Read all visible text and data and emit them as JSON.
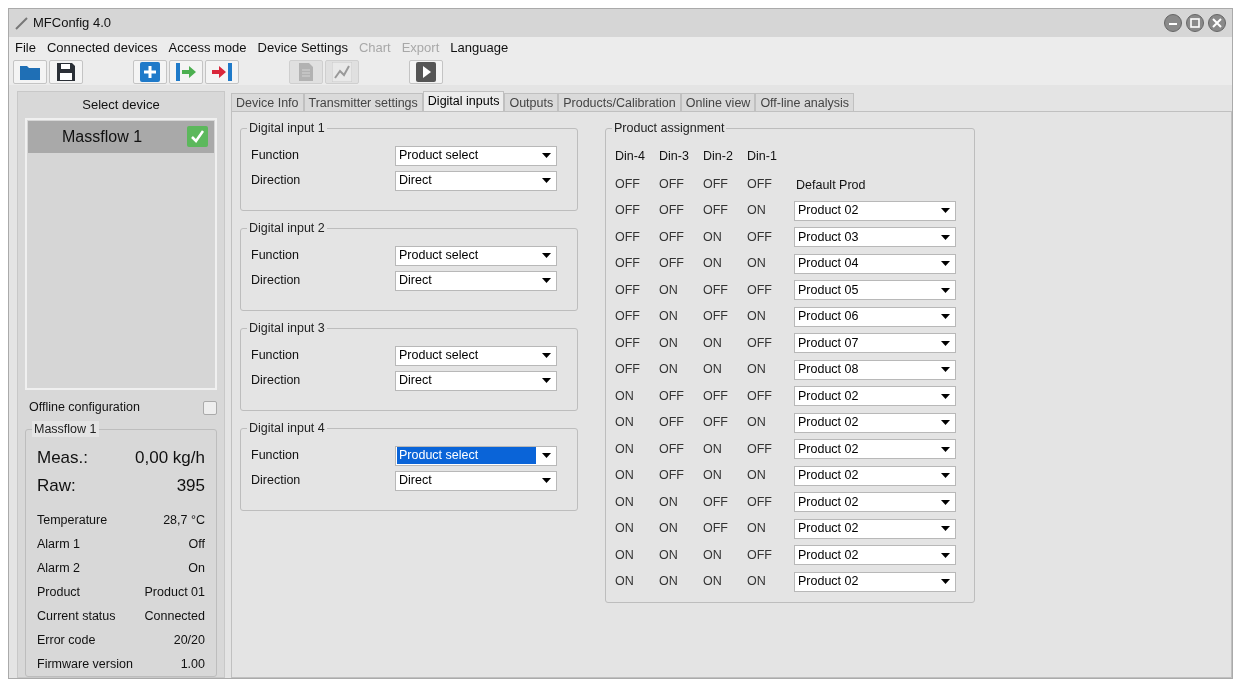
{
  "window": {
    "title": "MFConfig 4.0"
  },
  "menu": [
    {
      "label": "File",
      "disabled": false
    },
    {
      "label": "Connected devices",
      "disabled": false
    },
    {
      "label": "Access mode",
      "disabled": false
    },
    {
      "label": "Device Settings",
      "disabled": false
    },
    {
      "label": "Chart",
      "disabled": true
    },
    {
      "label": "Export",
      "disabled": true
    },
    {
      "label": "Language",
      "disabled": false
    }
  ],
  "toolbar": [
    {
      "kind": "open",
      "disabled": false
    },
    {
      "kind": "save",
      "disabled": false
    },
    {
      "kind": "gap"
    },
    {
      "kind": "add",
      "disabled": false
    },
    {
      "kind": "connect",
      "disabled": false
    },
    {
      "kind": "disconnect",
      "disabled": false
    },
    {
      "kind": "gap"
    },
    {
      "kind": "document",
      "disabled": true
    },
    {
      "kind": "chart",
      "disabled": true
    },
    {
      "kind": "gap"
    },
    {
      "kind": "play",
      "disabled": false
    }
  ],
  "sidebar": {
    "title": "Select device",
    "devices": [
      {
        "name": "Massflow 1",
        "selected": true,
        "connected": true
      }
    ],
    "offline": {
      "label": "Offline configuration",
      "checked": false
    },
    "status": {
      "title": "Massflow 1",
      "big": [
        {
          "label": "Meas.:",
          "value": "0,00 kg/h"
        },
        {
          "label": "Raw:",
          "value": "395"
        }
      ],
      "rows": [
        {
          "label": "Temperature",
          "value": "28,7 °C"
        },
        {
          "label": "Alarm 1",
          "value": "Off"
        },
        {
          "label": "Alarm 2",
          "value": "On"
        },
        {
          "label": "Product",
          "value": "Product 01"
        },
        {
          "label": "Current status",
          "value": "Connected"
        },
        {
          "label": "Error code",
          "value": "20/20"
        },
        {
          "label": "Firmware version",
          "value": "1.00"
        }
      ]
    }
  },
  "tabs": [
    {
      "label": "Device Info",
      "selected": false
    },
    {
      "label": "Transmitter settings",
      "selected": false
    },
    {
      "label": "Digital inputs",
      "selected": true
    },
    {
      "label": "Outputs",
      "selected": false
    },
    {
      "label": "Products/Calibration",
      "selected": false
    },
    {
      "label": "Online view",
      "selected": false
    },
    {
      "label": "Off-line analysis",
      "selected": false
    }
  ],
  "digital_inputs": [
    {
      "title": "Digital input 1",
      "fields": [
        {
          "label": "Function",
          "value": "Product select",
          "focused": false
        },
        {
          "label": "Direction",
          "value": "Direct",
          "focused": false
        }
      ]
    },
    {
      "title": "Digital input 2",
      "fields": [
        {
          "label": "Function",
          "value": "Product select",
          "focused": false
        },
        {
          "label": "Direction",
          "value": "Direct",
          "focused": false
        }
      ]
    },
    {
      "title": "Digital input 3",
      "fields": [
        {
          "label": "Function",
          "value": "Product select",
          "focused": false
        },
        {
          "label": "Direction",
          "value": "Direct",
          "focused": false
        }
      ]
    },
    {
      "title": "Digital input 4",
      "fields": [
        {
          "label": "Function",
          "value": "Product select",
          "focused": true
        },
        {
          "label": "Direction",
          "value": "Direct",
          "focused": false
        }
      ]
    }
  ],
  "product_assignment": {
    "title": "Product assignment",
    "columns": [
      "Din-4",
      "Din-3",
      "Din-2",
      "Din-1"
    ],
    "rows": [
      {
        "states": [
          "OFF",
          "OFF",
          "OFF",
          "OFF"
        ],
        "kind": "text",
        "product": "Default Prod"
      },
      {
        "states": [
          "OFF",
          "OFF",
          "OFF",
          "ON"
        ],
        "kind": "select",
        "product": "Product 02"
      },
      {
        "states": [
          "OFF",
          "OFF",
          "ON",
          "OFF"
        ],
        "kind": "select",
        "product": "Product 03"
      },
      {
        "states": [
          "OFF",
          "OFF",
          "ON",
          "ON"
        ],
        "kind": "select",
        "product": "Product 04"
      },
      {
        "states": [
          "OFF",
          "ON",
          "OFF",
          "OFF"
        ],
        "kind": "select",
        "product": "Product 05"
      },
      {
        "states": [
          "OFF",
          "ON",
          "OFF",
          "ON"
        ],
        "kind": "select",
        "product": "Product 06"
      },
      {
        "states": [
          "OFF",
          "ON",
          "ON",
          "OFF"
        ],
        "kind": "select",
        "product": "Product 07"
      },
      {
        "states": [
          "OFF",
          "ON",
          "ON",
          "ON"
        ],
        "kind": "select",
        "product": "Product 08"
      },
      {
        "states": [
          "ON",
          "OFF",
          "OFF",
          "OFF"
        ],
        "kind": "select",
        "product": "Product 02"
      },
      {
        "states": [
          "ON",
          "OFF",
          "OFF",
          "ON"
        ],
        "kind": "select",
        "product": "Product 02"
      },
      {
        "states": [
          "ON",
          "OFF",
          "ON",
          "OFF"
        ],
        "kind": "select",
        "product": "Product 02"
      },
      {
        "states": [
          "ON",
          "OFF",
          "ON",
          "ON"
        ],
        "kind": "select",
        "product": "Product 02"
      },
      {
        "states": [
          "ON",
          "ON",
          "OFF",
          "OFF"
        ],
        "kind": "select",
        "product": "Product 02"
      },
      {
        "states": [
          "ON",
          "ON",
          "OFF",
          "ON"
        ],
        "kind": "select",
        "product": "Product 02"
      },
      {
        "states": [
          "ON",
          "ON",
          "ON",
          "OFF"
        ],
        "kind": "select",
        "product": "Product 02"
      },
      {
        "states": [
          "ON",
          "ON",
          "ON",
          "ON"
        ],
        "kind": "select",
        "product": "Product 02"
      }
    ]
  }
}
